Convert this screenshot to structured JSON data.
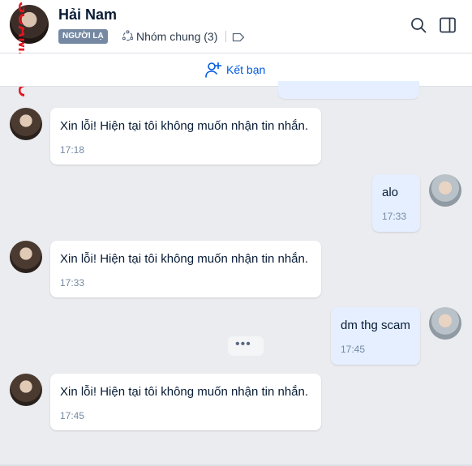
{
  "header": {
    "name": "Hải Nam",
    "badge": "NGƯỜI LẠ",
    "common_groups": "Nhóm chung (3)",
    "watermark": "SCAM.INFO"
  },
  "friend_bar": {
    "label": "Kết bạn"
  },
  "colors": {
    "accent": "#005ae0",
    "mine_bubble": "#e5efff",
    "badge": "#7589a3"
  },
  "messages": [
    {
      "sender": "contact",
      "text": "Xin lỗi! Hiện tại tôi không muốn nhận tin nhắn.",
      "time": "17:18"
    },
    {
      "sender": "me",
      "text": "alo",
      "time": "17:33"
    },
    {
      "sender": "contact",
      "text": "Xin lỗi! Hiện tại tôi không muốn nhận tin nhắn.",
      "time": "17:33"
    },
    {
      "sender": "me",
      "text": "dm thg scam",
      "time": "17:45"
    },
    {
      "sender": "contact",
      "text": "Xin lỗi! Hiện tại tôi không muốn nhận tin nhắn.",
      "time": "17:45"
    }
  ],
  "more_label": "•••"
}
